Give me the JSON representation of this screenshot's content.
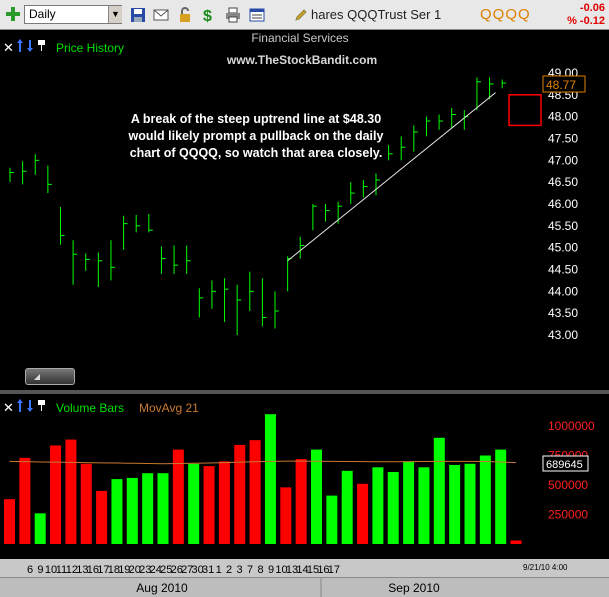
{
  "toolbar": {
    "interval": "Daily",
    "symbol_name": "hares QQQTrust Ser 1",
    "ticker": "QQQQ",
    "change_abs": "-0.06",
    "change_pct": "% -0.12"
  },
  "price_panel": {
    "title": "Price History",
    "sector": "Financial Services",
    "watermark": "www.TheStockBandit.com",
    "annotation": [
      "A break of the steep uptrend line at $48.30",
      "would likely prompt a pullback on the daily",
      "chart of QQQQ, so watch that area closely."
    ],
    "last_price": "48.77",
    "axis_labels": [
      "49.00",
      "48.50",
      "48.00",
      "47.50",
      "47.00",
      "46.50",
      "46.00",
      "45.50",
      "45.00",
      "44.50",
      "44.00",
      "43.50",
      "43.00"
    ]
  },
  "volume_panel": {
    "title": "Volume Bars",
    "ma_label": "MovAvg 21",
    "last_ma": "689645",
    "axis_labels": [
      "1000000",
      "750000",
      "500000",
      "250000"
    ]
  },
  "x_axis": {
    "days": [
      "6",
      "9",
      "10",
      "11",
      "12",
      "13",
      "16",
      "17",
      "18",
      "19",
      "20",
      "23",
      "24",
      "25",
      "26",
      "27",
      "30",
      "31",
      "1",
      "2",
      "3",
      "7",
      "8",
      "9",
      "10",
      "13",
      "14",
      "15",
      "16",
      "17"
    ],
    "months": [
      "Aug 2010",
      "Sep 2010"
    ],
    "timestamp": "9/21/10 4:00"
  },
  "colors": {
    "up": "#00ff00",
    "down": "#ff0000",
    "moving_average": "#c87830",
    "label_green": "#00e000",
    "price_axis": "#ffffff",
    "volume_axis": "#ff2020",
    "ticker_orange": "#e08000"
  },
  "chart_data": {
    "type": "bar",
    "price_ohlc": [
      {
        "date": "Aug 4",
        "high": 46.83,
        "low": 46.5,
        "close": 46.72
      },
      {
        "date": "Aug 5",
        "high": 46.98,
        "low": 46.45,
        "close": 46.75
      },
      {
        "date": "Aug 6",
        "high": 47.14,
        "low": 46.67,
        "close": 47.0
      },
      {
        "date": "Aug 9",
        "high": 46.88,
        "low": 46.25,
        "close": 46.45
      },
      {
        "date": "Aug 10",
        "high": 45.93,
        "low": 45.07,
        "close": 45.28
      },
      {
        "date": "Aug 11",
        "high": 45.17,
        "low": 44.15,
        "close": 44.85
      },
      {
        "date": "Aug 12",
        "high": 44.87,
        "low": 44.47,
        "close": 44.73
      },
      {
        "date": "Aug 13",
        "high": 44.89,
        "low": 44.1,
        "close": 44.7
      },
      {
        "date": "Aug 16",
        "high": 45.17,
        "low": 44.25,
        "close": 44.55
      },
      {
        "date": "Aug 17",
        "high": 45.73,
        "low": 44.95,
        "close": 45.55
      },
      {
        "date": "Aug 18",
        "high": 45.75,
        "low": 45.35,
        "close": 45.5
      },
      {
        "date": "Aug 19",
        "high": 45.77,
        "low": 45.35,
        "close": 45.4
      },
      {
        "date": "Aug 20",
        "high": 45.03,
        "low": 44.4,
        "close": 44.75
      },
      {
        "date": "Aug 23",
        "high": 45.05,
        "low": 44.4,
        "close": 44.6
      },
      {
        "date": "Aug 24",
        "high": 45.05,
        "low": 44.4,
        "close": 44.7
      },
      {
        "date": "Aug 25",
        "high": 44.07,
        "low": 43.4,
        "close": 43.85
      },
      {
        "date": "Aug 26",
        "high": 44.25,
        "low": 43.6,
        "close": 44.0
      },
      {
        "date": "Aug 27",
        "high": 44.3,
        "low": 43.3,
        "close": 44.05
      },
      {
        "date": "Aug 30",
        "high": 44.15,
        "low": 43.0,
        "close": 43.8
      },
      {
        "date": "Aug 31",
        "high": 44.45,
        "low": 43.55,
        "close": 44.0
      },
      {
        "date": "Sep 1",
        "high": 44.3,
        "low": 43.2,
        "close": 43.4
      },
      {
        "date": "Sep 2",
        "high": 44.0,
        "low": 43.15,
        "close": 43.55
      },
      {
        "date": "Sep 3",
        "high": 44.8,
        "low": 44.0,
        "close": 44.75
      },
      {
        "date": "Sep 7",
        "high": 45.25,
        "low": 44.75,
        "close": 45.05
      },
      {
        "date": "Sep 8",
        "high": 46.0,
        "low": 45.4,
        "close": 45.95
      },
      {
        "date": "Sep 9",
        "high": 46.0,
        "low": 45.6,
        "close": 45.85
      },
      {
        "date": "Sep 10",
        "high": 46.05,
        "low": 45.55,
        "close": 45.95
      },
      {
        "date": "Sep 13",
        "high": 46.5,
        "low": 46.0,
        "close": 46.25
      },
      {
        "date": "Sep 14",
        "high": 46.55,
        "low": 46.15,
        "close": 46.4
      },
      {
        "date": "Sep 15",
        "high": 46.7,
        "low": 46.2,
        "close": 46.55
      },
      {
        "date": "Sep 16",
        "high": 47.35,
        "low": 47.0,
        "close": 47.15
      },
      {
        "date": "Sep 17",
        "high": 47.55,
        "low": 47.0,
        "close": 47.3
      },
      {
        "date": "Sep 20",
        "high": 47.8,
        "low": 47.2,
        "close": 47.65
      },
      {
        "date": "Sep 21",
        "high": 48.0,
        "low": 47.55,
        "close": 47.9
      },
      {
        "date": "Sep 22",
        "high": 48.05,
        "low": 47.7,
        "close": 47.9
      },
      {
        "date": "Sep 23",
        "high": 48.2,
        "low": 47.75,
        "close": 48.05
      },
      {
        "date": "Sep 24",
        "high": 48.15,
        "low": 47.7,
        "close": 48.0
      },
      {
        "date": "Sep 27",
        "high": 48.9,
        "low": 48.15,
        "close": 48.8
      },
      {
        "date": "Sep 28",
        "high": 48.9,
        "low": 48.4,
        "close": 48.75
      },
      {
        "date": "Sep 29",
        "high": 48.85,
        "low": 48.65,
        "close": 48.77
      }
    ],
    "volume": [
      {
        "value": 380000,
        "dir": "down"
      },
      {
        "value": 730000,
        "dir": "down"
      },
      {
        "value": 260000,
        "dir": "up"
      },
      {
        "value": 835000,
        "dir": "down"
      },
      {
        "value": 885000,
        "dir": "down"
      },
      {
        "value": 680000,
        "dir": "down"
      },
      {
        "value": 450000,
        "dir": "down"
      },
      {
        "value": 550000,
        "dir": "up"
      },
      {
        "value": 560000,
        "dir": "up"
      },
      {
        "value": 600000,
        "dir": "up"
      },
      {
        "value": 600000,
        "dir": "up"
      },
      {
        "value": 800000,
        "dir": "down"
      },
      {
        "value": 680000,
        "dir": "up"
      },
      {
        "value": 660000,
        "dir": "down"
      },
      {
        "value": 700000,
        "dir": "down"
      },
      {
        "value": 840000,
        "dir": "down"
      },
      {
        "value": 880000,
        "dir": "down"
      },
      {
        "value": 1100000,
        "dir": "up"
      },
      {
        "value": 480000,
        "dir": "down"
      },
      {
        "value": 720000,
        "dir": "down"
      },
      {
        "value": 800000,
        "dir": "up"
      },
      {
        "value": 410000,
        "dir": "up"
      },
      {
        "value": 620000,
        "dir": "up"
      },
      {
        "value": 510000,
        "dir": "down"
      },
      {
        "value": 650000,
        "dir": "up"
      },
      {
        "value": 610000,
        "dir": "up"
      },
      {
        "value": 700000,
        "dir": "up"
      },
      {
        "value": 650000,
        "dir": "up"
      },
      {
        "value": 900000,
        "dir": "up"
      },
      {
        "value": 670000,
        "dir": "up"
      },
      {
        "value": 680000,
        "dir": "up"
      },
      {
        "value": 750000,
        "dir": "up"
      },
      {
        "value": 800000,
        "dir": "up"
      },
      {
        "value": 30000,
        "dir": "down"
      }
    ],
    "moving_average_21": [
      700000,
      698000,
      695000,
      694000,
      692000,
      690000,
      688000,
      686000,
      684000,
      682000,
      680000,
      682000,
      684000,
      686000,
      690000,
      694000,
      697000,
      700000,
      702000,
      702000,
      701000,
      700000,
      699000,
      698000,
      697000,
      697000,
      698000,
      699000,
      700000,
      700000,
      700000,
      699000,
      695000,
      689645
    ],
    "price_ylim": [
      43.0,
      49.0
    ],
    "volume_ylim": [
      0,
      1000000
    ],
    "trendline": {
      "start": {
        "date": "Sep 3",
        "price": 44.7
      },
      "end": {
        "date": "Sep 28",
        "price": 48.55
      }
    },
    "alert_box": {
      "price_range": [
        47.8,
        48.5
      ]
    }
  }
}
